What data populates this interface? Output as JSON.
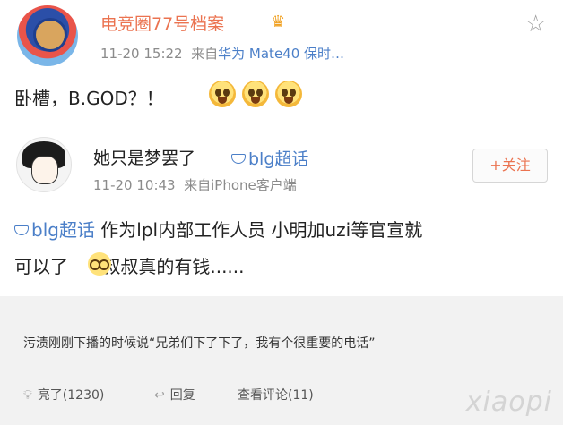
{
  "post": {
    "author": "电竞圈77号档案",
    "vip_icon": "crown-icon",
    "time": "11-20 15:22",
    "source_prefix": "来自",
    "source_device": "华为 Mate40 保时…",
    "text": "卧槽，B.GOD？！",
    "emoji_count": 3
  },
  "repost": {
    "author": "她只是梦罢了",
    "topic": "blg超话",
    "follow_label": "+关注",
    "time": "11-20 10:43",
    "source": "来自iPhone客户端",
    "topic_inline": "blg超话",
    "line1_text": " 作为lpl内部工作人员 小明加uzi等官宣就",
    "line2_prefix": "可以了",
    "line2_suffix": " 叔叔真的有钱......"
  },
  "comment": {
    "text": "污渍刚刚下播的时候说“兄弟们下了下了，我有个很重要的电话”",
    "like_label": "亮了(1230)",
    "reply_label": "回复",
    "view_label": "查看评论(11)"
  },
  "watermark": "xiaopi"
}
